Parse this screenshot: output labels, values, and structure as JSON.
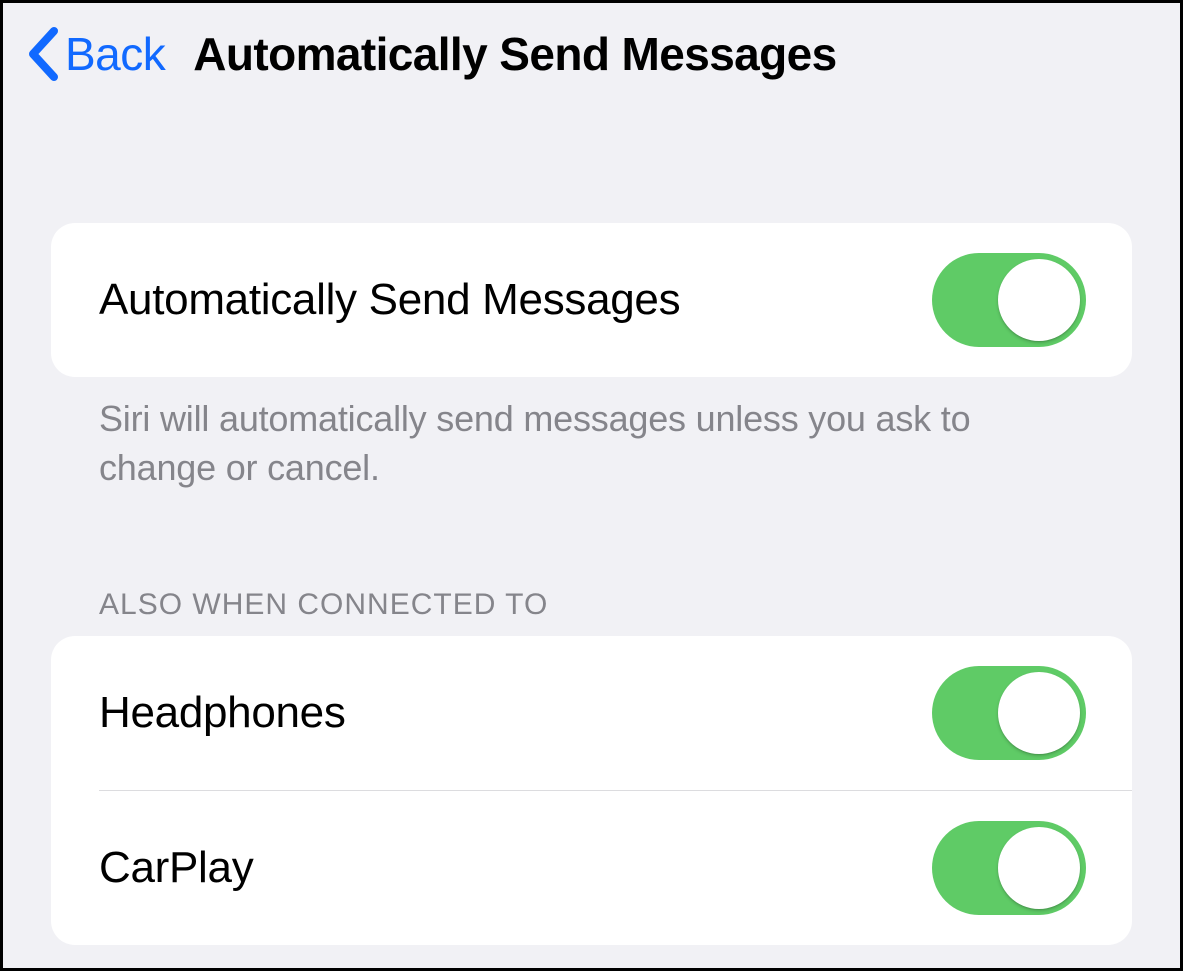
{
  "nav": {
    "back_label": "Back",
    "title": "Automatically Send Messages"
  },
  "section1": {
    "toggle_label": "Automatically Send Messages",
    "toggle_on": true,
    "footer": "Siri will automatically send messages unless you ask to change or cancel."
  },
  "section2": {
    "header": "ALSO WHEN CONNECTED TO",
    "rows": [
      {
        "label": "Headphones",
        "on": true
      },
      {
        "label": "CarPlay",
        "on": true
      }
    ]
  },
  "colors": {
    "accent_blue": "#1169ff",
    "toggle_green": "#5fcb66",
    "bg": "#f1f1f5"
  }
}
